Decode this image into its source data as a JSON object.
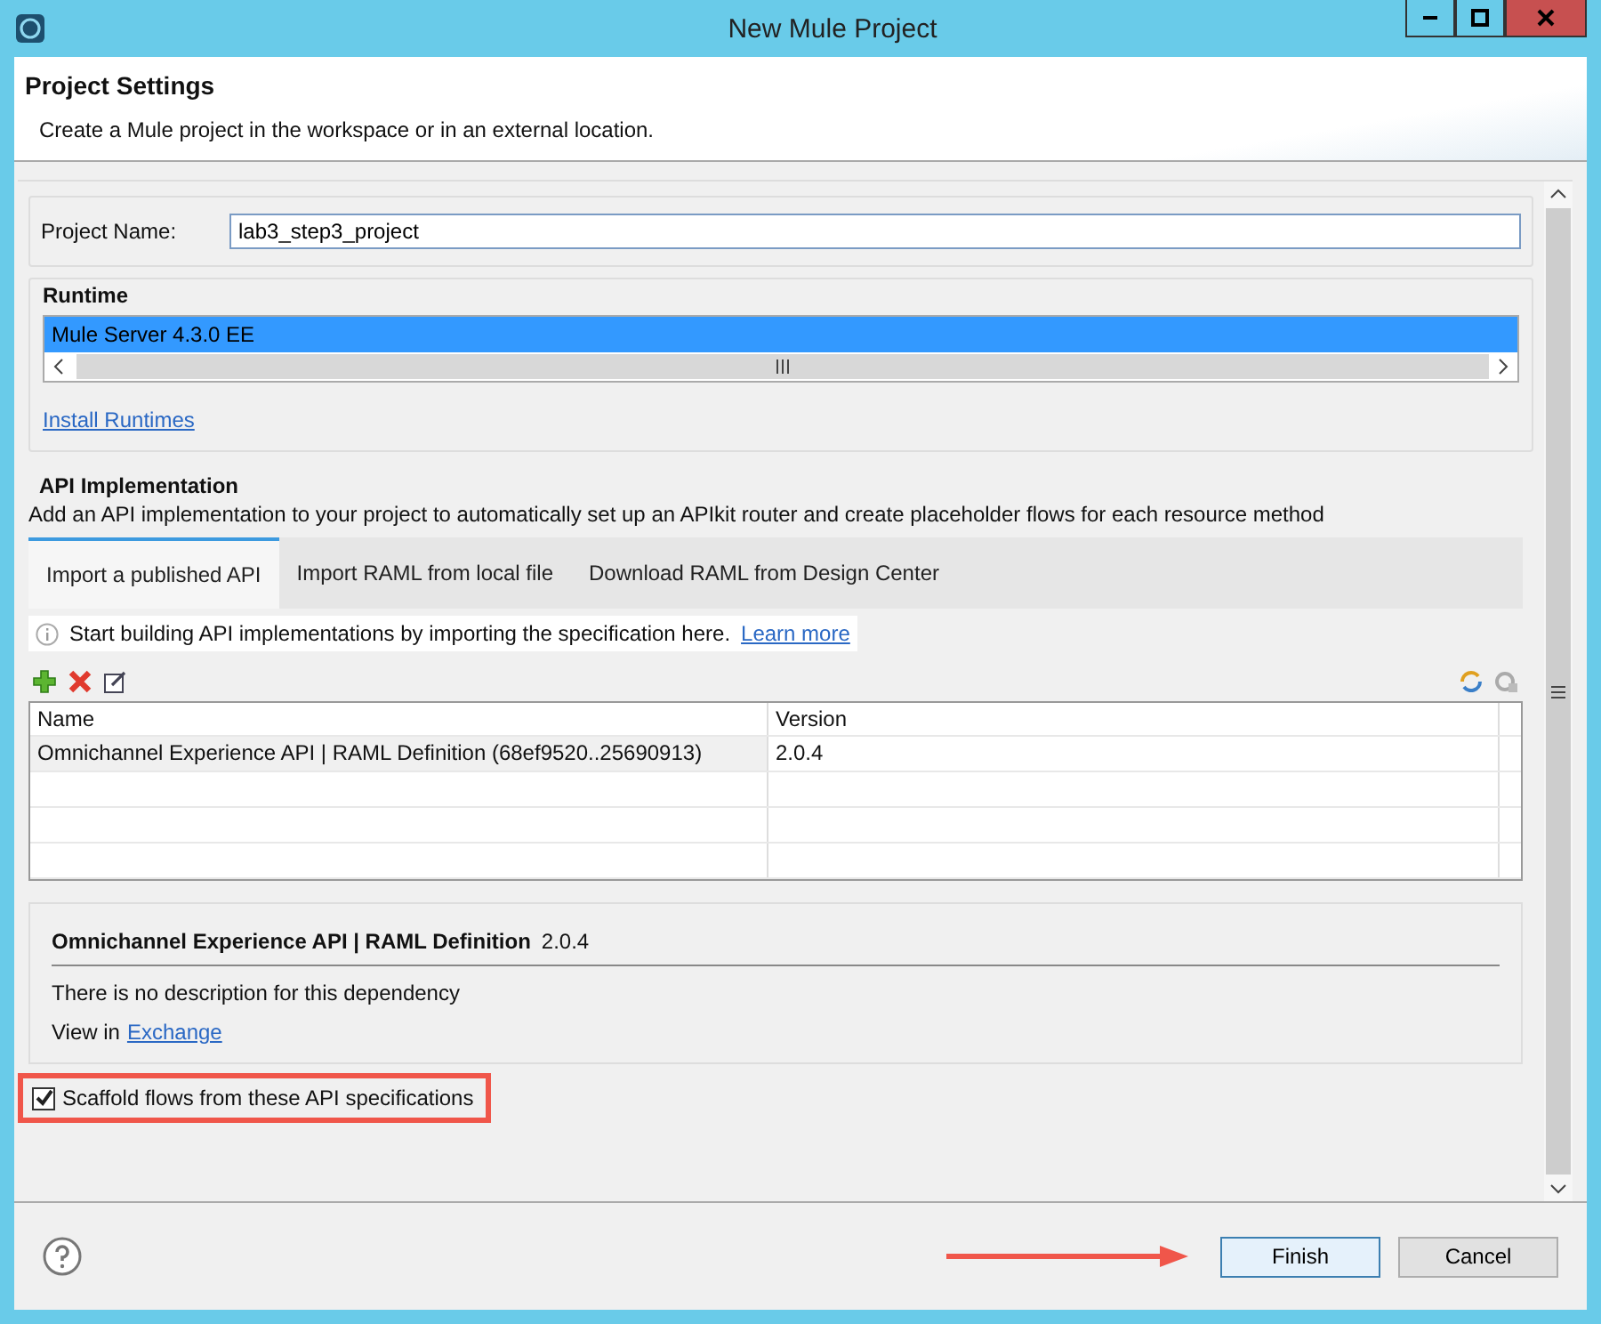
{
  "window": {
    "title": "New Mule Project"
  },
  "header": {
    "title": "Project Settings",
    "description": "Create a Mule project in the workspace or in an external location."
  },
  "project_name": {
    "label": "Project Name:",
    "value": "lab3_step3_project"
  },
  "runtime": {
    "title": "Runtime",
    "items": [
      {
        "label": "Mule Server 4.3.0 EE",
        "selected": true
      }
    ],
    "install_link": "Install Runtimes"
  },
  "api_implementation": {
    "title": "API Implementation",
    "description": "Add an API implementation to your project to automatically set up an APIkit router and create placeholder flows for each resource method",
    "tabs": [
      {
        "label": "Import a published API",
        "selected": true
      },
      {
        "label": "Import RAML from local file",
        "selected": false
      },
      {
        "label": "Download RAML from Design Center",
        "selected": false
      }
    ],
    "info": {
      "text": "Start building API implementations by importing the specification here.",
      "link": "Learn more"
    },
    "table": {
      "columns": [
        "Name",
        "Version"
      ],
      "rows": [
        {
          "cells": [
            "Omnichannel Experience API | RAML Definition (68ef9520..25690913)",
            "2.0.4"
          ],
          "selected": false
        }
      ]
    },
    "details": {
      "title": "Omnichannel Experience API | RAML Definition",
      "version": "2.0.4",
      "description": "There is no description for this dependency",
      "view_label": "View in",
      "view_link": "Exchange"
    },
    "scaffold": {
      "label": "Scaffold flows from these API specifications",
      "checked": true
    }
  },
  "buttons": [
    {
      "label": "Finish",
      "kind": "default"
    },
    {
      "label": "Cancel",
      "kind": "normal"
    }
  ]
}
